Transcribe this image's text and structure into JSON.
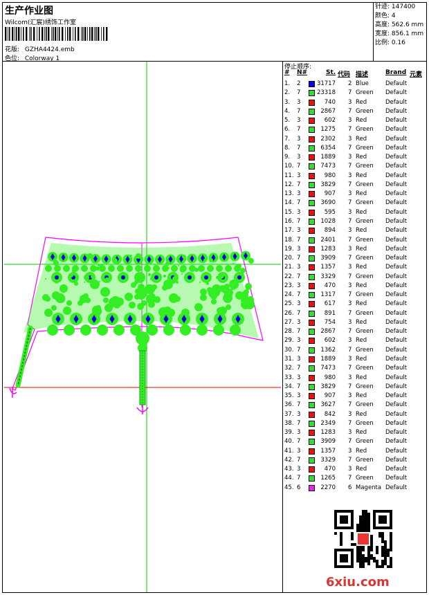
{
  "header": {
    "title": "生产作业图",
    "company": "Wilcom(汇宸)绣饰工作室",
    "design_label": "花版:",
    "design_value": "GZHA4424.emb",
    "colorway_label": "色位:",
    "colorway_value": "Colorway 1"
  },
  "specs": [
    {
      "label": "针迹:",
      "value": "147400"
    },
    {
      "label": "颜色:",
      "value": "4"
    },
    {
      "label": "高度:",
      "value": "562.6 mm"
    },
    {
      "label": "宽度:",
      "value": "856.1 mm"
    },
    {
      "label": "比例:",
      "value": "0.16"
    }
  ],
  "stop_sequence": {
    "title": "停止顺序:",
    "headers": {
      "index": "#",
      "needle": "N#",
      "stitches": "St.",
      "code": "代码",
      "description": "描述",
      "brand": "Brand",
      "element": "元素"
    },
    "rows": [
      {
        "idx": "1.",
        "n": "2",
        "st": "31717",
        "code": "2",
        "desc": "Blue",
        "brand": "Default",
        "color": "#0000ff"
      },
      {
        "idx": "2.",
        "n": "7",
        "st": "23318",
        "code": "7",
        "desc": "Green",
        "brand": "Default",
        "color": "#33dd33"
      },
      {
        "idx": "3.",
        "n": "3",
        "st": "740",
        "code": "3",
        "desc": "Red",
        "brand": "Default",
        "color": "#ee1111"
      },
      {
        "idx": "4.",
        "n": "7",
        "st": "2867",
        "code": "7",
        "desc": "Green",
        "brand": "Default",
        "color": "#33dd33"
      },
      {
        "idx": "5.",
        "n": "3",
        "st": "602",
        "code": "3",
        "desc": "Red",
        "brand": "Default",
        "color": "#ee1111"
      },
      {
        "idx": "6.",
        "n": "7",
        "st": "1275",
        "code": "7",
        "desc": "Green",
        "brand": "Default",
        "color": "#33dd33"
      },
      {
        "idx": "7.",
        "n": "3",
        "st": "2302",
        "code": "3",
        "desc": "Red",
        "brand": "Default",
        "color": "#ee1111"
      },
      {
        "idx": "8.",
        "n": "7",
        "st": "6354",
        "code": "7",
        "desc": "Green",
        "brand": "Default",
        "color": "#33dd33"
      },
      {
        "idx": "9.",
        "n": "3",
        "st": "1889",
        "code": "3",
        "desc": "Red",
        "brand": "Default",
        "color": "#ee1111"
      },
      {
        "idx": "10.",
        "n": "7",
        "st": "7473",
        "code": "7",
        "desc": "Green",
        "brand": "Default",
        "color": "#33dd33"
      },
      {
        "idx": "11.",
        "n": "3",
        "st": "980",
        "code": "3",
        "desc": "Red",
        "brand": "Default",
        "color": "#ee1111"
      },
      {
        "idx": "12.",
        "n": "7",
        "st": "3829",
        "code": "7",
        "desc": "Green",
        "brand": "Default",
        "color": "#33dd33"
      },
      {
        "idx": "13.",
        "n": "3",
        "st": "907",
        "code": "3",
        "desc": "Red",
        "brand": "Default",
        "color": "#ee1111"
      },
      {
        "idx": "14.",
        "n": "7",
        "st": "3690",
        "code": "7",
        "desc": "Green",
        "brand": "Default",
        "color": "#33dd33"
      },
      {
        "idx": "15.",
        "n": "3",
        "st": "595",
        "code": "3",
        "desc": "Red",
        "brand": "Default",
        "color": "#ee1111"
      },
      {
        "idx": "16.",
        "n": "7",
        "st": "1028",
        "code": "7",
        "desc": "Green",
        "brand": "Default",
        "color": "#33dd33"
      },
      {
        "idx": "17.",
        "n": "3",
        "st": "894",
        "code": "3",
        "desc": "Red",
        "brand": "Default",
        "color": "#ee1111"
      },
      {
        "idx": "18.",
        "n": "7",
        "st": "2401",
        "code": "7",
        "desc": "Green",
        "brand": "Default",
        "color": "#33dd33"
      },
      {
        "idx": "19.",
        "n": "3",
        "st": "1283",
        "code": "3",
        "desc": "Red",
        "brand": "Default",
        "color": "#ee1111"
      },
      {
        "idx": "20.",
        "n": "7",
        "st": "3909",
        "code": "7",
        "desc": "Green",
        "brand": "Default",
        "color": "#33dd33"
      },
      {
        "idx": "21.",
        "n": "3",
        "st": "1357",
        "code": "3",
        "desc": "Red",
        "brand": "Default",
        "color": "#ee1111"
      },
      {
        "idx": "22.",
        "n": "7",
        "st": "3329",
        "code": "7",
        "desc": "Green",
        "brand": "Default",
        "color": "#33dd33"
      },
      {
        "idx": "23.",
        "n": "3",
        "st": "470",
        "code": "3",
        "desc": "Red",
        "brand": "Default",
        "color": "#ee1111"
      },
      {
        "idx": "24.",
        "n": "7",
        "st": "1317",
        "code": "7",
        "desc": "Green",
        "brand": "Default",
        "color": "#33dd33"
      },
      {
        "idx": "25.",
        "n": "3",
        "st": "617",
        "code": "3",
        "desc": "Red",
        "brand": "Default",
        "color": "#ee1111"
      },
      {
        "idx": "26.",
        "n": "7",
        "st": "891",
        "code": "7",
        "desc": "Green",
        "brand": "Default",
        "color": "#33dd33"
      },
      {
        "idx": "27.",
        "n": "3",
        "st": "754",
        "code": "3",
        "desc": "Red",
        "brand": "Default",
        "color": "#ee1111"
      },
      {
        "idx": "28.",
        "n": "7",
        "st": "2867",
        "code": "7",
        "desc": "Green",
        "brand": "Default",
        "color": "#33dd33"
      },
      {
        "idx": "29.",
        "n": "3",
        "st": "602",
        "code": "3",
        "desc": "Red",
        "brand": "Default",
        "color": "#ee1111"
      },
      {
        "idx": "30.",
        "n": "7",
        "st": "1362",
        "code": "7",
        "desc": "Green",
        "brand": "Default",
        "color": "#33dd33"
      },
      {
        "idx": "31.",
        "n": "3",
        "st": "1889",
        "code": "3",
        "desc": "Red",
        "brand": "Default",
        "color": "#ee1111"
      },
      {
        "idx": "32.",
        "n": "7",
        "st": "7473",
        "code": "7",
        "desc": "Green",
        "brand": "Default",
        "color": "#33dd33"
      },
      {
        "idx": "33.",
        "n": "3",
        "st": "980",
        "code": "3",
        "desc": "Red",
        "brand": "Default",
        "color": "#ee1111"
      },
      {
        "idx": "34.",
        "n": "7",
        "st": "3829",
        "code": "7",
        "desc": "Green",
        "brand": "Default",
        "color": "#33dd33"
      },
      {
        "idx": "35.",
        "n": "3",
        "st": "907",
        "code": "3",
        "desc": "Red",
        "brand": "Default",
        "color": "#ee1111"
      },
      {
        "idx": "36.",
        "n": "7",
        "st": "3627",
        "code": "7",
        "desc": "Green",
        "brand": "Default",
        "color": "#33dd33"
      },
      {
        "idx": "37.",
        "n": "3",
        "st": "842",
        "code": "3",
        "desc": "Red",
        "brand": "Default",
        "color": "#ee1111"
      },
      {
        "idx": "38.",
        "n": "7",
        "st": "2349",
        "code": "7",
        "desc": "Green",
        "brand": "Default",
        "color": "#33dd33"
      },
      {
        "idx": "39.",
        "n": "3",
        "st": "1283",
        "code": "3",
        "desc": "Red",
        "brand": "Default",
        "color": "#ee1111"
      },
      {
        "idx": "40.",
        "n": "7",
        "st": "3909",
        "code": "7",
        "desc": "Green",
        "brand": "Default",
        "color": "#33dd33"
      },
      {
        "idx": "41.",
        "n": "3",
        "st": "1357",
        "code": "3",
        "desc": "Red",
        "brand": "Default",
        "color": "#ee1111"
      },
      {
        "idx": "42.",
        "n": "7",
        "st": "3329",
        "code": "7",
        "desc": "Green",
        "brand": "Default",
        "color": "#33dd33"
      },
      {
        "idx": "43.",
        "n": "3",
        "st": "470",
        "code": "3",
        "desc": "Red",
        "brand": "Default",
        "color": "#ee1111"
      },
      {
        "idx": "44.",
        "n": "7",
        "st": "1265",
        "code": "7",
        "desc": "Green",
        "brand": "Default",
        "color": "#33dd33"
      },
      {
        "idx": "45.",
        "n": "6",
        "st": "2270",
        "code": "6",
        "desc": "Magenta",
        "brand": "Default",
        "color": "#ee22ee"
      }
    ]
  },
  "watermark": "6xiu.com",
  "colors": {
    "outline": "#ff00ff",
    "guide_h_top": "#00cc00",
    "guide_v": "#00cc00",
    "guide_h_bottom": "#ee0000",
    "green": "#33ee22",
    "blue": "#0000dd"
  }
}
